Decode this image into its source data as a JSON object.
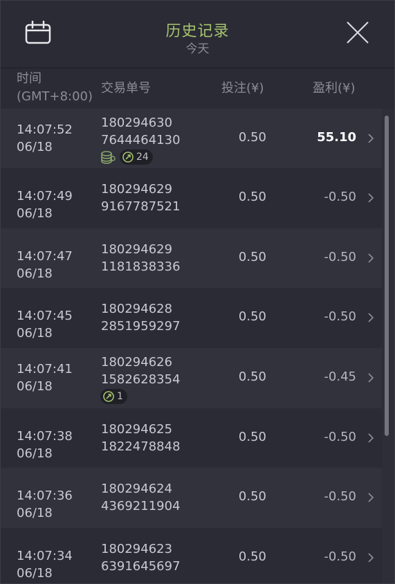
{
  "header": {
    "title": "历史记录",
    "subtitle": "今天",
    "calendar_icon": "calendar-icon",
    "close_icon": "close-icon"
  },
  "columns": {
    "time_line1": "时间",
    "time_line2": "(GMT+8:00)",
    "transaction": "交易单号",
    "bet": "投注(¥)",
    "profit": "盈利(¥)"
  },
  "rows": [
    {
      "time": "14:07:52",
      "date": "06/18",
      "tx1": "180294630",
      "tx2": "7644464130",
      "bet": "0.50",
      "profit": "55.10",
      "win": true,
      "coins": true,
      "spins": "24"
    },
    {
      "time": "14:07:49",
      "date": "06/18",
      "tx1": "180294629",
      "tx2": "9167787521",
      "bet": "0.50",
      "profit": "-0.50"
    },
    {
      "time": "14:07:47",
      "date": "06/18",
      "tx1": "180294629",
      "tx2": "1181838336",
      "bet": "0.50",
      "profit": "-0.50"
    },
    {
      "time": "14:07:45",
      "date": "06/18",
      "tx1": "180294628",
      "tx2": "2851959297",
      "bet": "0.50",
      "profit": "-0.50"
    },
    {
      "time": "14:07:41",
      "date": "06/18",
      "tx1": "180294626",
      "tx2": "1582628354",
      "bet": "0.50",
      "profit": "-0.45",
      "spins": "1"
    },
    {
      "time": "14:07:38",
      "date": "06/18",
      "tx1": "180294625",
      "tx2": "1822478848",
      "bet": "0.50",
      "profit": "-0.50"
    },
    {
      "time": "14:07:36",
      "date": "06/18",
      "tx1": "180294624",
      "tx2": "4369211904",
      "bet": "0.50",
      "profit": "-0.50"
    },
    {
      "time": "14:07:34",
      "date": "06/18",
      "tx1": "180294623",
      "tx2": "6391645697",
      "bet": "0.50",
      "profit": "-0.50"
    }
  ],
  "colors": {
    "title": "#a6c36f",
    "background": "#2a2b34",
    "row_alt": "#31323c",
    "win_text": "#ffffff"
  }
}
